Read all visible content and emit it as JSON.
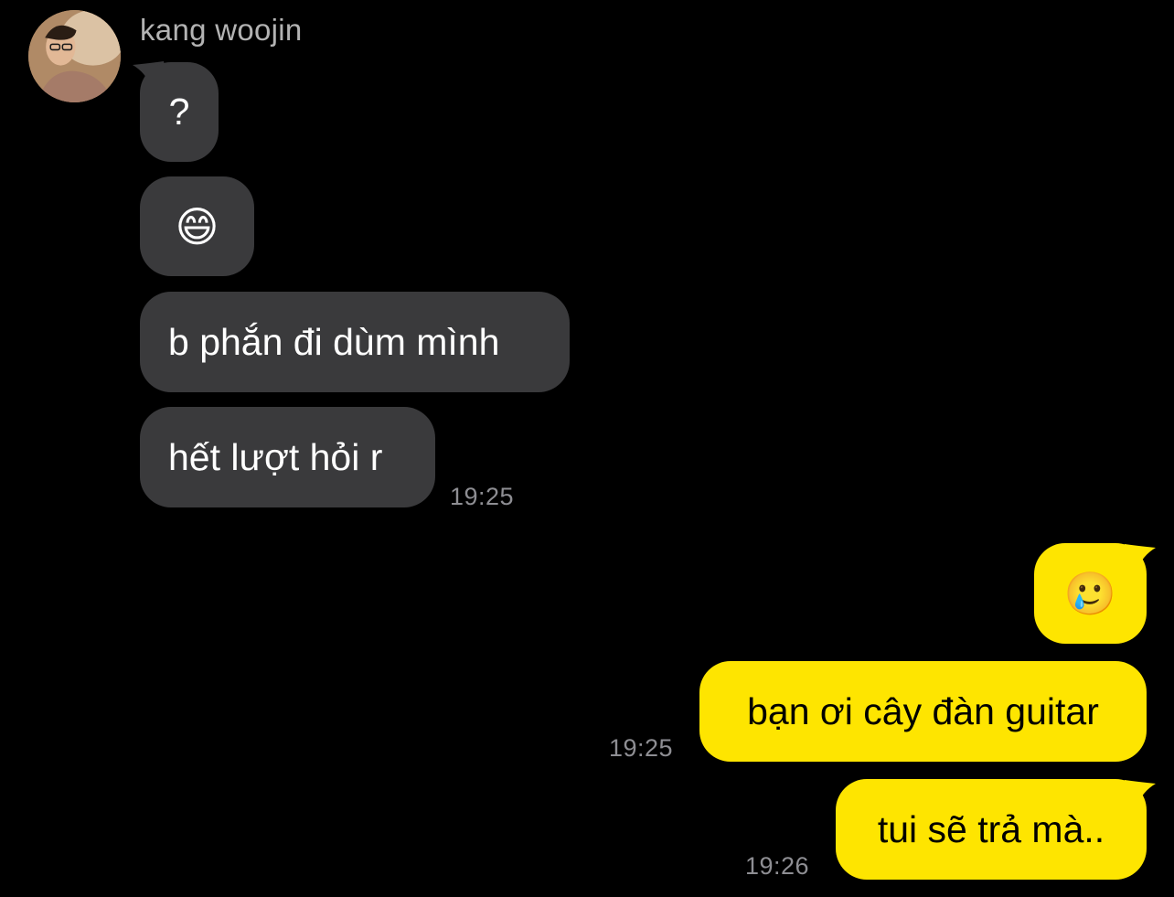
{
  "chat": {
    "sender_name": "kang woojin",
    "incoming": [
      {
        "text": "?"
      },
      {
        "emoji": "😄",
        "emoji_name": "grinning-face-with-smiling-eyes"
      },
      {
        "text": "b phắn đi dùm mình"
      },
      {
        "text": "hết lượt hỏi r"
      }
    ],
    "incoming_time": "19:25",
    "outgoing": [
      {
        "emoji": "🥲",
        "emoji_name": "smiling-face-with-tear"
      },
      {
        "text": "bạn ơi cây đàn guitar",
        "time": "19:25"
      },
      {
        "text": "tui sẽ trả mà..",
        "time": "19:26"
      }
    ]
  },
  "colors": {
    "background": "#000000",
    "incoming_bubble": "#3a3a3c",
    "outgoing_bubble": "#fee500",
    "timestamp": "#8e8e93",
    "sender_name": "#b3b3b3"
  }
}
